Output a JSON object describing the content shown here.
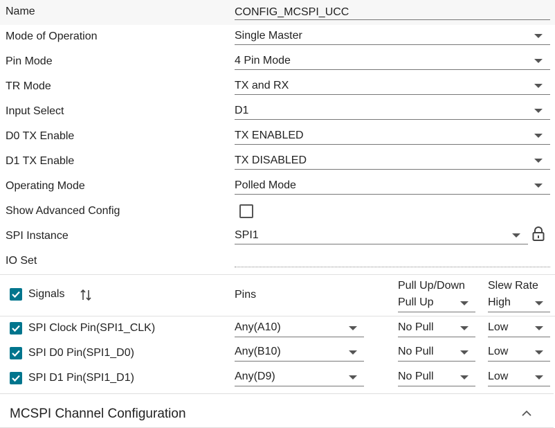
{
  "fields": [
    {
      "label": "Name",
      "value": "CONFIG_MCSPI_UCC",
      "kind": "text"
    },
    {
      "label": "Mode of Operation",
      "value": "Single Master",
      "kind": "select"
    },
    {
      "label": "Pin Mode",
      "value": "4 Pin Mode",
      "kind": "select"
    },
    {
      "label": "TR Mode",
      "value": "TX and RX",
      "kind": "select"
    },
    {
      "label": "Input Select",
      "value": "D1",
      "kind": "select"
    },
    {
      "label": "D0 TX Enable",
      "value": "TX ENABLED",
      "kind": "select"
    },
    {
      "label": "D1 TX Enable",
      "value": "TX DISABLED",
      "kind": "select"
    },
    {
      "label": "Operating Mode",
      "value": "Polled Mode",
      "kind": "select"
    }
  ],
  "advanced": {
    "label": "Show Advanced Config",
    "checked": false
  },
  "spi_instance": {
    "label": "SPI Instance",
    "value": "SPI1",
    "icon": "lock-icon"
  },
  "io_set": {
    "label": "IO Set",
    "value": ""
  },
  "signals_table": {
    "header": {
      "signals_label": "Signals",
      "signals_checked": true,
      "sort_icon": "sort-icon",
      "pins_label": "Pins",
      "pull_label": "Pull Up/Down",
      "pull_value": "Pull Up",
      "slew_label": "Slew Rate",
      "slew_value": "High"
    },
    "rows": [
      {
        "name": "SPI Clock Pin(SPI1_CLK)",
        "checked": true,
        "pin": "Any(A10)",
        "pull": "No Pull",
        "slew": "Low"
      },
      {
        "name": "SPI D0 Pin(SPI1_D0)",
        "checked": true,
        "pin": "Any(B10)",
        "pull": "No Pull",
        "slew": "Low"
      },
      {
        "name": "SPI D1 Pin(SPI1_D1)",
        "checked": true,
        "pin": "Any(D9)",
        "pull": "No Pull",
        "slew": "Low"
      }
    ]
  },
  "section": {
    "title": "MCSPI Channel Configuration",
    "icon": "chevron-up-icon"
  },
  "colors": {
    "accent": "#00758d",
    "underline": "#777777"
  }
}
